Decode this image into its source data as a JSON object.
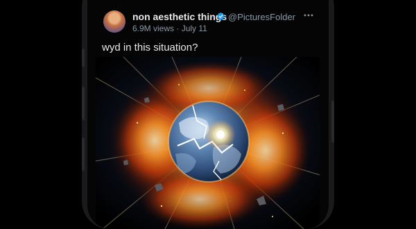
{
  "post": {
    "author_name": "non aesthetic things",
    "handle": "@PicturesFolder",
    "views": "6.9M views",
    "separator": "·",
    "date": "July 11",
    "text": "wyd in this situation?"
  },
  "icons": {
    "verified": "verified-badge-icon",
    "more": "more-options-icon"
  },
  "colors": {
    "background": "#000000",
    "text_primary": "#e7e9ea",
    "text_secondary": "#8b98a5",
    "verified_blue": "#1d9bf0"
  }
}
